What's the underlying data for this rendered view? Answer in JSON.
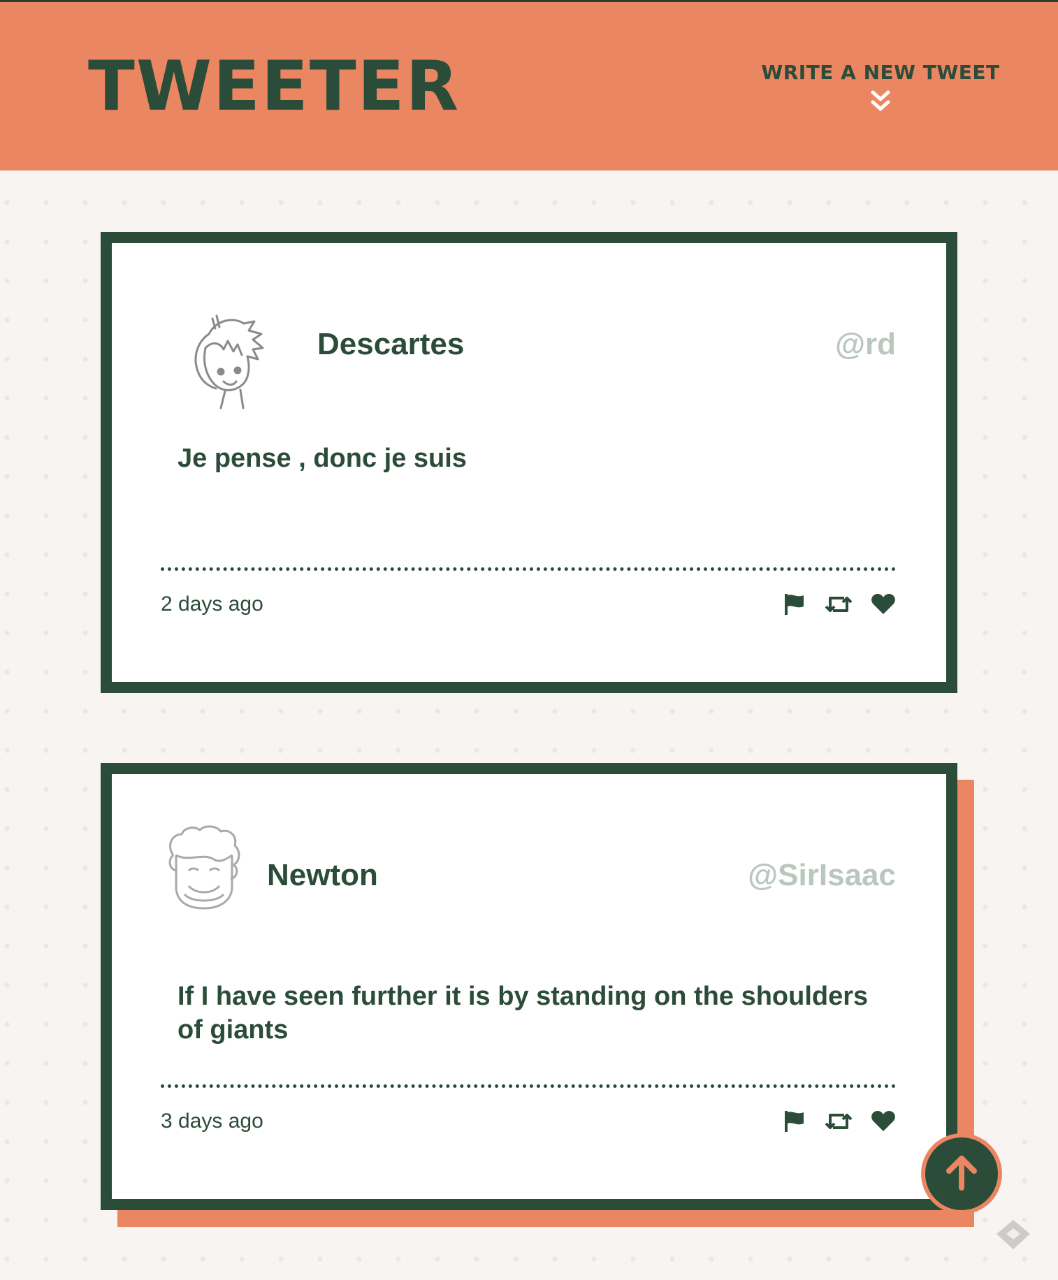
{
  "header": {
    "logo": "TWEETER",
    "compose_label": "WRITE A NEW TWEET",
    "compose_icon": "double-chevron-down-icon"
  },
  "tweets": [
    {
      "name": "Descartes",
      "handle": "@rd",
      "content": "Je pense , donc je suis",
      "time": "2 days ago",
      "avatar": "cartoon-boy-avatar"
    },
    {
      "name": "Newton",
      "handle": "@SirIsaac",
      "content": "If I have seen further it is by standing on the shoulders of giants",
      "time": "3 days ago",
      "avatar": "curly-hair-avatar"
    }
  ],
  "actions": [
    "flag-icon",
    "retweet-icon",
    "heart-icon"
  ],
  "colors": {
    "accent": "#eb8662",
    "primary": "#2b4c38",
    "muted": "#b9c7be",
    "background": "#f8f4f1"
  },
  "scroll_top_icon": "arrow-up-icon"
}
